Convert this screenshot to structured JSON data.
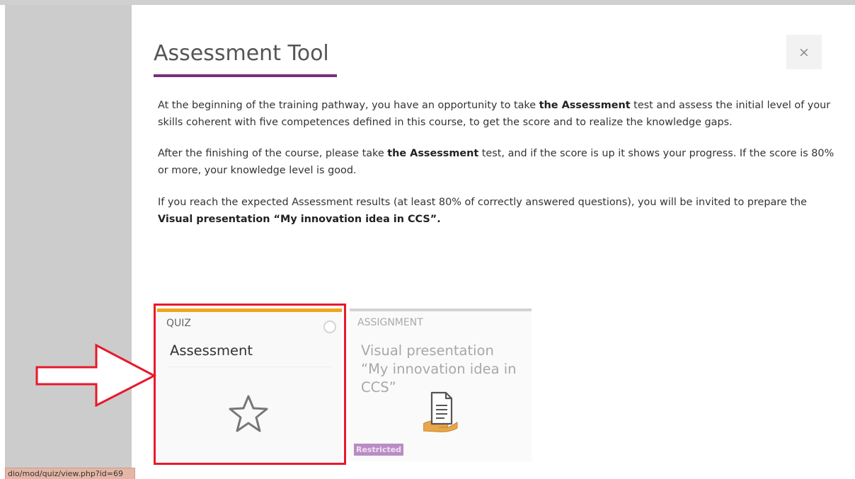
{
  "modal": {
    "title": "Assessment Tool",
    "close_icon": "×",
    "paragraphs": [
      {
        "before": "At the beginning of the training pathway, you have an opportunity to take ",
        "bold": "the Assessment",
        "after": " test and assess the initial level of your skills coherent with five competences defined in this course, to get the score and to realize the knowledge gaps."
      },
      {
        "before": "After the finishing of the course, please take ",
        "bold": "the Assessment",
        "after": " test, and if the score is up it shows your progress. If the score is 80% or more, your knowledge level is good."
      },
      {
        "before": "If you reach the expected Assessment results (at least 80% of correctly answered questions), you will be invited to prepare the ",
        "bold": "Visual presentation “My innovation idea in CCS”.",
        "after": ""
      }
    ]
  },
  "activities": [
    {
      "type": "QUIZ",
      "name": "Assessment",
      "icon": "star-icon",
      "accent_color": "#f0a61d"
    },
    {
      "type": "ASSIGNMENT",
      "name": "Visual presentation “My innovation idea in CCS”",
      "icon": "assignment-document-icon",
      "badge": "Restricted",
      "accent_color": "#d3d3d3"
    }
  ],
  "annotation": {
    "highlight_color": "#e8192c"
  },
  "status_bar": {
    "url": "dio/mod/quiz/view.php?id=69"
  },
  "colors": {
    "title_underline": "#7a2d82",
    "badge": "#b98dc4"
  }
}
